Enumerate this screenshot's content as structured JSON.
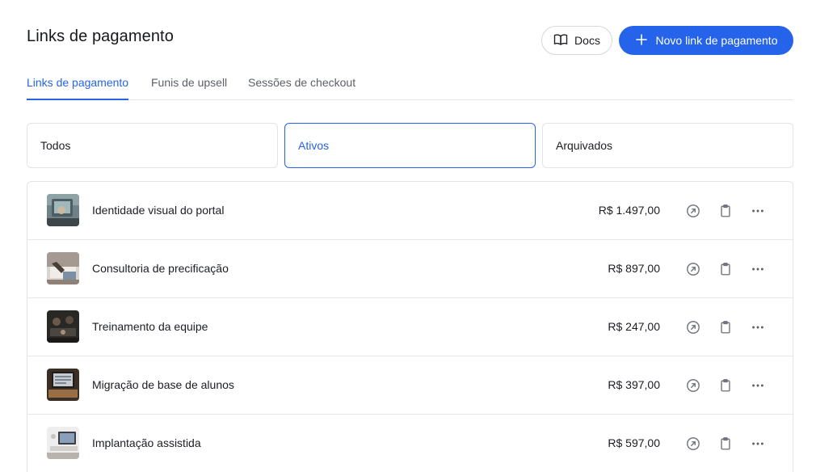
{
  "header": {
    "title": "Links de pagamento",
    "docs_label": "Docs",
    "new_label": "Novo link de pagamento"
  },
  "tabs": [
    {
      "label": "Links de pagamento",
      "active": true
    },
    {
      "label": "Funis de upsell",
      "active": false
    },
    {
      "label": "Sessões de checkout",
      "active": false
    }
  ],
  "filters": [
    {
      "label": "Todos",
      "active": false
    },
    {
      "label": "Ativos",
      "active": true
    },
    {
      "label": "Arquivados",
      "active": false
    }
  ],
  "rows": [
    {
      "name": "Identidade visual do portal",
      "price": "R$ 1.497,00"
    },
    {
      "name": "Consultoria de precificação",
      "price": "R$ 897,00"
    },
    {
      "name": "Treinamento da equipe",
      "price": "R$ 247,00"
    },
    {
      "name": "Migração de base de alunos",
      "price": "R$ 397,00"
    },
    {
      "name": "Implantação assistida",
      "price": "R$ 597,00"
    }
  ],
  "colors": {
    "accent": "#2563eb",
    "border": "#e1e3e6",
    "text": "#1b1d22",
    "muted": "#5c6068"
  },
  "icons": {
    "docs": "book-icon",
    "new": "plus-icon",
    "open": "arrow-up-right-circle-icon",
    "copy": "clipboard-icon",
    "more": "more-horizontal-icon"
  }
}
